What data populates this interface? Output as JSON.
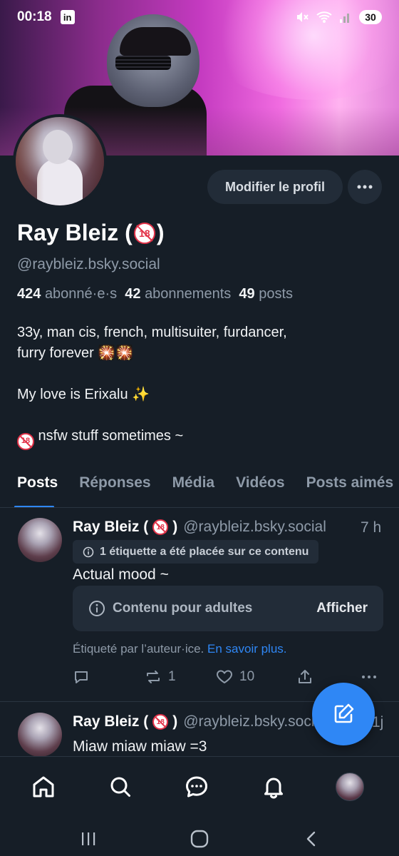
{
  "status_bar": {
    "time": "00:18",
    "app_badge": "in",
    "battery": "30"
  },
  "profile": {
    "edit_label": "Modifier le profil",
    "display_name": "Ray Bleiz (",
    "display_name_end": ")",
    "handle": "@raybleiz.bsky.social",
    "followers_count": "424",
    "followers_label": "abonné·e·s",
    "following_count": "42",
    "following_label": "abonnements",
    "posts_count": "49",
    "posts_label": "posts",
    "bio_line1": "33y, man cis, french, multisuiter, furdancer,",
    "bio_line2": "furry forever 🎇🎇",
    "bio_line3": "My love is Erixalu ✨",
    "bio_line4": " nsfw stuff sometimes ~",
    "badge_text": "18"
  },
  "tabs": [
    {
      "label": "Posts",
      "active": true
    },
    {
      "label": "Réponses",
      "active": false
    },
    {
      "label": "Média",
      "active": false
    },
    {
      "label": "Vidéos",
      "active": false
    },
    {
      "label": "Posts aimés",
      "active": false
    }
  ],
  "posts": [
    {
      "author": "Ray Bleiz (",
      "author_end": ")",
      "handle": "@raybleiz.bsky.social",
      "time": "7 h",
      "label_notice": "1 étiquette a été placée sur ce contenu",
      "text": "Actual mood ~",
      "adult_label": "Contenu pour adultes",
      "show_label": "Afficher",
      "labeled_by": "Étiqueté par l’auteur·ice.",
      "learn_more": "En savoir plus.",
      "reposts": "1",
      "likes": "10"
    },
    {
      "author": "Ray Bleiz (",
      "author_end": ")",
      "handle": "@raybleiz.bsky.social",
      "time": "1j",
      "text": "Miaw miaw miaw =3"
    }
  ],
  "colors": {
    "background": "#161e27",
    "accent": "#2f87f5",
    "surface": "#222c38",
    "muted": "#8e9aa8",
    "nsfw_red": "#e3344a"
  },
  "icons": {
    "nav": [
      "home-icon",
      "search-icon",
      "chat-icon",
      "bell-icon",
      "profile-avatar"
    ],
    "system": [
      "recent-apps-icon",
      "home-circle-icon",
      "back-icon"
    ]
  }
}
